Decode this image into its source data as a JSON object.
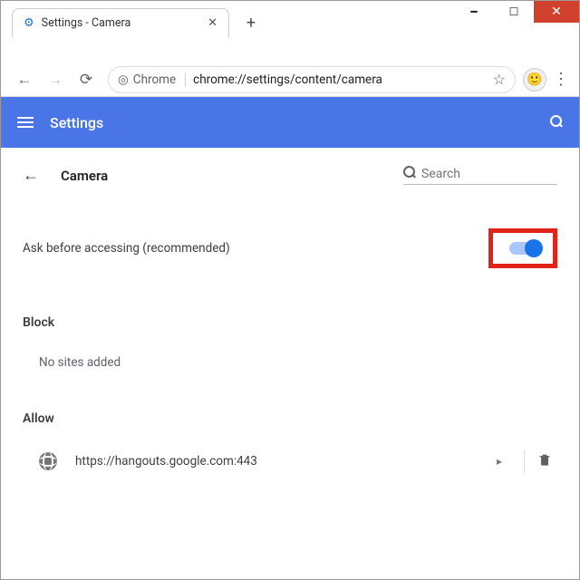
{
  "window": {
    "tab_title": "Settings - Camera"
  },
  "omnibox": {
    "prefix": "Chrome",
    "url": "chrome://settings/content/camera"
  },
  "header": {
    "title": "Settings"
  },
  "page": {
    "title": "Camera",
    "search_placeholder": "Search",
    "toggle_label": "Ask before accessing (recommended)",
    "toggle_on": true,
    "block": {
      "label": "Block",
      "empty_text": "No sites added"
    },
    "allow": {
      "label": "Allow",
      "sites": [
        {
          "url": "https://hangouts.google.com:443"
        }
      ]
    }
  }
}
